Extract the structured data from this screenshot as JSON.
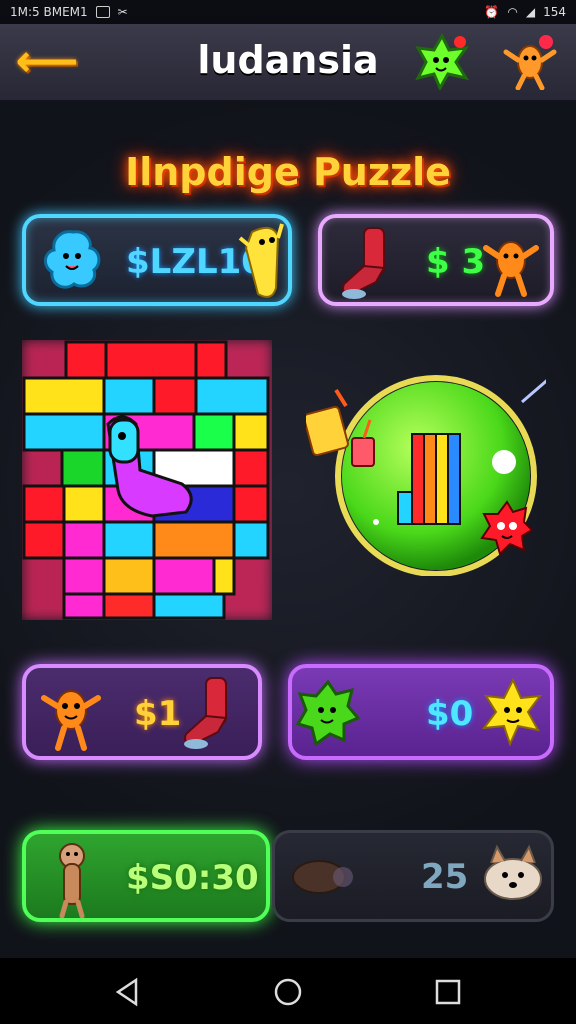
{
  "status_bar": {
    "left_text": "1M:5 BMEM1",
    "right_text": "154"
  },
  "header": {
    "back_icon": "arrow-left-icon",
    "title": "ludansia",
    "icons": [
      "green-star-creature-icon",
      "orange-creature-icon"
    ]
  },
  "subtitle": "Ilnpdige Puzzle",
  "cards": [
    {
      "id": "blue-blob",
      "value": "$LZL10",
      "color": "#4fd7ff",
      "icons": [
        "blue-blob-icon",
        "yellow-creature-icon"
      ]
    },
    {
      "id": "sock",
      "value": "$ 3",
      "color": "#3dff45",
      "icons": [
        "red-sock-icon",
        "orange-creature-icon"
      ]
    },
    {
      "id": "orange",
      "value": "$1",
      "color": "#ffd23a",
      "icons": [
        "orange-creature-icon",
        "red-sock-icon"
      ]
    },
    {
      "id": "green",
      "value": "$0",
      "color": "#4fe7ff",
      "icons": [
        "green-blob-icon",
        "yellow-star-icon"
      ]
    },
    {
      "id": "timer",
      "value": "$S0:30",
      "color": "#b9ff7a",
      "icons": [
        "ferret-icon"
      ]
    },
    {
      "id": "locked",
      "value": "25",
      "color": "#7fa8c0",
      "icons": [
        "chestnut-icon",
        "dog-icon"
      ]
    }
  ],
  "puzzle": {
    "icon": "block-puzzle-board",
    "piece_icon": "cyan-sock-piece-icon"
  },
  "orb": {
    "icon": "green-orb-rainbow-boot",
    "decor_icons": [
      "drink-icon",
      "red-splat-creature-icon"
    ]
  },
  "nav": [
    "back-triangle-icon",
    "home-circle-icon",
    "recents-square-icon"
  ]
}
